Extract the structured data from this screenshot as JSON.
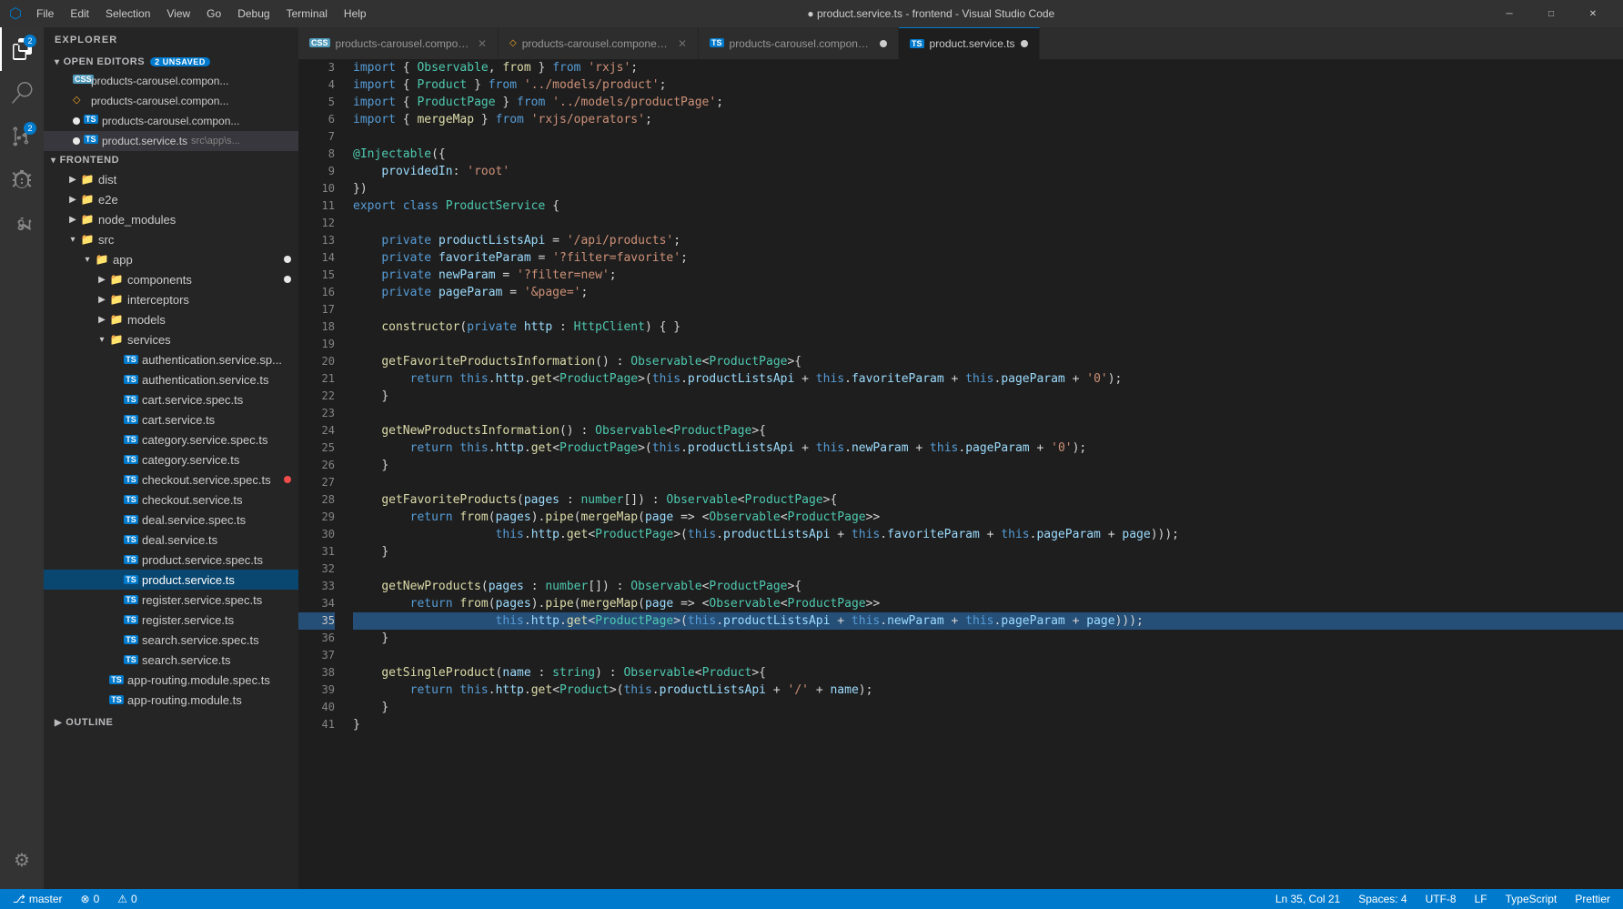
{
  "titlebar": {
    "title": "● product.service.ts - frontend - Visual Studio Code",
    "menu_items": [
      "File",
      "Edit",
      "Selection",
      "View",
      "Go",
      "Debug",
      "Terminal",
      "Help"
    ]
  },
  "activity_bar": {
    "items": [
      {
        "name": "explorer",
        "icon": "📄",
        "active": true,
        "badge": "2"
      },
      {
        "name": "search",
        "icon": "🔍",
        "active": false
      },
      {
        "name": "source-control",
        "icon": "⎇",
        "active": false,
        "badge": "2"
      },
      {
        "name": "debug",
        "icon": "▶",
        "active": false
      },
      {
        "name": "extensions",
        "icon": "⊞",
        "active": false
      }
    ],
    "bottom_items": [
      {
        "name": "settings",
        "icon": "⚙"
      }
    ]
  },
  "sidebar": {
    "title": "EXPLORER",
    "open_editors": {
      "label": "OPEN EDITORS",
      "badge": "2 UNSAVED",
      "files": [
        {
          "name": "products-carousel.compon...",
          "type": "css",
          "dirty": false
        },
        {
          "name": "products-carousel.compon...",
          "type": "html",
          "dirty": false
        },
        {
          "name": "products-carousel.compon...",
          "type": "ts",
          "dirty": true
        },
        {
          "name": "product.service.ts",
          "type": "ts",
          "dirty": true,
          "path": "src\\app\\s...",
          "active": true
        }
      ]
    },
    "tree": {
      "root": "FRONTEND",
      "items": [
        {
          "label": "dist",
          "type": "folder",
          "depth": 1,
          "expanded": false
        },
        {
          "label": "e2e",
          "type": "folder",
          "depth": 1,
          "expanded": false
        },
        {
          "label": "node_modules",
          "type": "folder",
          "depth": 1,
          "expanded": false
        },
        {
          "label": "src",
          "type": "folder",
          "depth": 1,
          "expanded": true
        },
        {
          "label": "app",
          "type": "folder",
          "depth": 2,
          "expanded": true,
          "dirty": true
        },
        {
          "label": "components",
          "type": "folder",
          "depth": 3,
          "expanded": false,
          "dirty": true
        },
        {
          "label": "interceptors",
          "type": "folder",
          "depth": 3,
          "expanded": false
        },
        {
          "label": "models",
          "type": "folder",
          "depth": 3,
          "expanded": false
        },
        {
          "label": "services",
          "type": "folder",
          "depth": 3,
          "expanded": true
        },
        {
          "label": "authentication.service.sp...",
          "type": "ts",
          "depth": 4
        },
        {
          "label": "authentication.service.ts",
          "type": "ts",
          "depth": 4
        },
        {
          "label": "cart.service.spec.ts",
          "type": "ts",
          "depth": 4
        },
        {
          "label": "cart.service.ts",
          "type": "ts",
          "depth": 4
        },
        {
          "label": "category.service.spec.ts",
          "type": "ts",
          "depth": 4
        },
        {
          "label": "category.service.ts",
          "type": "ts",
          "depth": 4
        },
        {
          "label": "checkout.service.spec.ts",
          "type": "ts",
          "depth": 4,
          "dot": "red"
        },
        {
          "label": "checkout.service.ts",
          "type": "ts",
          "depth": 4
        },
        {
          "label": "deal.service.spec.ts",
          "type": "ts",
          "depth": 4
        },
        {
          "label": "deal.service.ts",
          "type": "ts",
          "depth": 4
        },
        {
          "label": "product.service.spec.ts",
          "type": "ts",
          "depth": 4
        },
        {
          "label": "product.service.ts",
          "type": "ts",
          "depth": 4,
          "active": true
        },
        {
          "label": "register.service.spec.ts",
          "type": "ts",
          "depth": 4
        },
        {
          "label": "register.service.ts",
          "type": "ts",
          "depth": 4
        },
        {
          "label": "search.service.spec.ts",
          "type": "ts",
          "depth": 4
        },
        {
          "label": "search.service.ts",
          "type": "ts",
          "depth": 4
        },
        {
          "label": "app-routing.module.spec.ts",
          "type": "ts",
          "depth": 3
        },
        {
          "label": "app-routing.module.ts",
          "type": "ts",
          "depth": 3
        }
      ]
    },
    "outline": "OUTLINE"
  },
  "tabs": [
    {
      "name": "products-carousel.component.css",
      "type": "css",
      "active": false,
      "dirty": false
    },
    {
      "name": "products-carousel.component.html",
      "type": "html",
      "active": false,
      "dirty": false
    },
    {
      "name": "products-carousel.component.ts",
      "type": "ts",
      "active": false,
      "dirty": true
    },
    {
      "name": "product.service.ts",
      "type": "ts",
      "active": true,
      "dirty": true
    }
  ],
  "code": {
    "lines": [
      {
        "num": 3,
        "content": "import { Observable, from } from 'rxjs';"
      },
      {
        "num": 4,
        "content": "import { Product } from '../models/product';"
      },
      {
        "num": 5,
        "content": "import { ProductPage } from '../models/productPage';"
      },
      {
        "num": 6,
        "content": "import { mergeMap } from 'rxjs/operators';"
      },
      {
        "num": 7,
        "content": ""
      },
      {
        "num": 8,
        "content": "@Injectable({"
      },
      {
        "num": 9,
        "content": "    providedIn: 'root'"
      },
      {
        "num": 10,
        "content": "})"
      },
      {
        "num": 11,
        "content": "export class ProductService {"
      },
      {
        "num": 12,
        "content": ""
      },
      {
        "num": 13,
        "content": "    private productListsApi = '/api/products';"
      },
      {
        "num": 14,
        "content": "    private favoriteParam = '?filter=favorite';"
      },
      {
        "num": 15,
        "content": "    private newParam = '?filter=new';"
      },
      {
        "num": 16,
        "content": "    private pageParam = '&page=';"
      },
      {
        "num": 17,
        "content": ""
      },
      {
        "num": 18,
        "content": "    constructor(private http : HttpClient) { }"
      },
      {
        "num": 19,
        "content": ""
      },
      {
        "num": 20,
        "content": "    getFavoriteProductsInformation() : Observable<ProductPage>{"
      },
      {
        "num": 21,
        "content": "        return this.http.get<ProductPage>(this.productListsApi + this.favoriteParam + this.pageParam + '0');"
      },
      {
        "num": 22,
        "content": "    }"
      },
      {
        "num": 23,
        "content": ""
      },
      {
        "num": 24,
        "content": "    getNewProductsInformation() : Observable<ProductPage>{"
      },
      {
        "num": 25,
        "content": "        return this.http.get<ProductPage>(this.productListsApi + this.newParam + this.pageParam + '0');"
      },
      {
        "num": 26,
        "content": "    }"
      },
      {
        "num": 27,
        "content": ""
      },
      {
        "num": 28,
        "content": "    getFavoriteProducts(pages : number[]) : Observable<ProductPage>{"
      },
      {
        "num": 29,
        "content": "        return from(pages).pipe(mergeMap(page => <Observable<ProductPage>>"
      },
      {
        "num": 30,
        "content": "                    this.http.get<ProductPage>(this.productListsApi + this.favoriteParam + this.pageParam + page)));"
      },
      {
        "num": 31,
        "content": "    }"
      },
      {
        "num": 32,
        "content": ""
      },
      {
        "num": 33,
        "content": "    getNewProducts(pages : number[]) : Observable<ProductPage>{"
      },
      {
        "num": 34,
        "content": "        return from(pages).pipe(mergeMap(page => <Observable<ProductPage>>"
      },
      {
        "num": 35,
        "content": "                    this.http.get<ProductPage>(this.productListsApi + this.newParam + this.pageParam + page)));"
      },
      {
        "num": 36,
        "content": "    }"
      },
      {
        "num": 37,
        "content": ""
      },
      {
        "num": 38,
        "content": "    getSingleProduct(name : string) : Observable<Product>{"
      },
      {
        "num": 39,
        "content": "        return this.http.get<Product>(this.productListsApi + '/' + name);"
      },
      {
        "num": 40,
        "content": "    }"
      },
      {
        "num": 41,
        "content": "}"
      }
    ]
  },
  "status_bar": {
    "branch": "⎇ master",
    "errors": "⊗ 0",
    "warnings": "⚠ 0",
    "right_items": [
      "Ln 35, Col 21",
      "Spaces: 4",
      "UTF-8",
      "LF",
      "TypeScript",
      "Prettier"
    ]
  }
}
